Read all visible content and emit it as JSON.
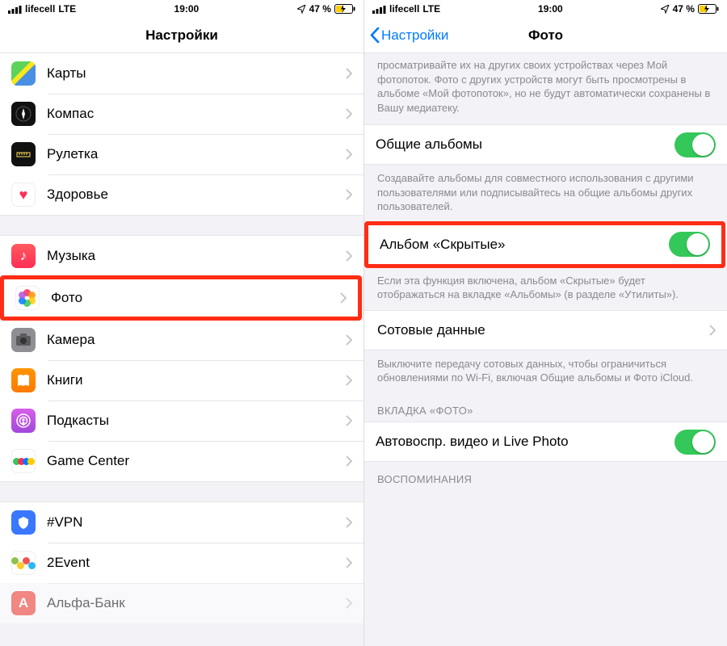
{
  "status": {
    "carrier": "lifecell",
    "network": "LTE",
    "time": "19:00",
    "battery": "47 %"
  },
  "left": {
    "title": "Настройки",
    "group1": [
      {
        "label": "Карты"
      },
      {
        "label": "Компас"
      },
      {
        "label": "Рулетка"
      },
      {
        "label": "Здоровье"
      }
    ],
    "group2": [
      {
        "label": "Музыка"
      },
      {
        "label": "Фото"
      },
      {
        "label": "Камера"
      },
      {
        "label": "Книги"
      },
      {
        "label": "Подкасты"
      },
      {
        "label": "Game Center"
      }
    ],
    "group3": [
      {
        "label": "#VPN"
      },
      {
        "label": "2Event"
      },
      {
        "label": "Альфа-Банк"
      }
    ]
  },
  "right": {
    "back": "Настройки",
    "title": "Фото",
    "top_text": "просматривайте их на других своих устройствах через Мой фотопоток. Фото с других устройств могут быть просмотрены в альбоме «Мой фотопоток», но не будут автоматически сохранены в Вашу медиатеку.",
    "shared_albums": "Общие альбомы",
    "shared_footer": "Создавайте альбомы для совместного использования с другими пользователями или подписывайтесь на общие альбомы других пользователей.",
    "hidden_album": "Альбом «Скрытые»",
    "hidden_footer": "Если эта функция включена, альбом «Скрытые» будет отображаться на вкладке «Альбомы» (в разделе «Утилиты»).",
    "cellular": "Сотовые данные",
    "cellular_footer": "Выключите передачу сотовых данных, чтобы ограничиться обновлениями по Wi-Fi, включая Общие альбомы и Фото iCloud.",
    "section_header": "ВКЛАДКА «ФОТО»",
    "autoplay": "Автовоспр. видео и Live Photo",
    "memories_header": "ВОСПОМИНАНИЯ"
  }
}
